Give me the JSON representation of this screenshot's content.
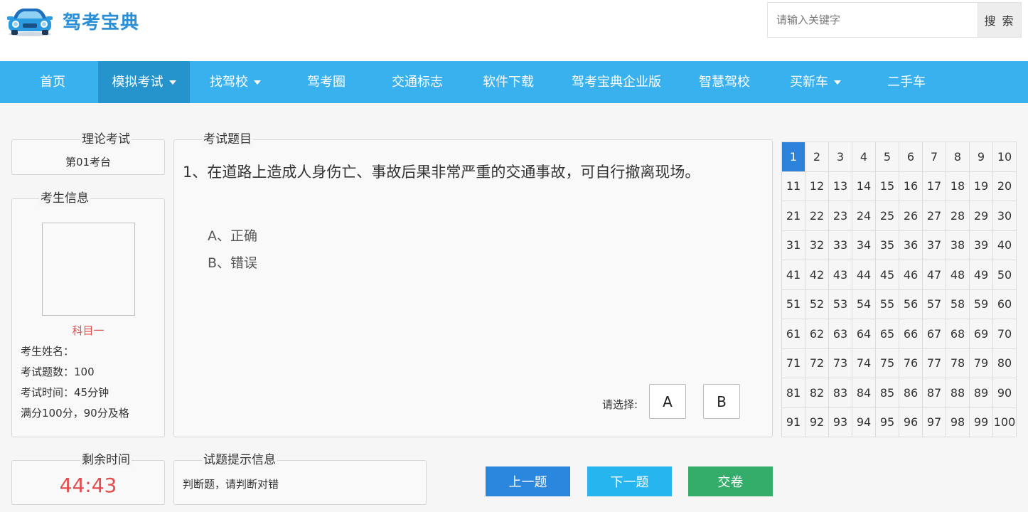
{
  "brand": {
    "name": "驾考宝典"
  },
  "search": {
    "placeholder": "请输入关键字",
    "button_label": "搜 索"
  },
  "nav": {
    "items": [
      {
        "label": "首页",
        "dropdown": false,
        "active": false
      },
      {
        "label": "模拟考试",
        "dropdown": true,
        "active": true
      },
      {
        "label": "找驾校",
        "dropdown": true,
        "active": false
      },
      {
        "label": "驾考圈",
        "dropdown": false,
        "active": false
      },
      {
        "label": "交通标志",
        "dropdown": false,
        "active": false
      },
      {
        "label": "软件下载",
        "dropdown": false,
        "active": false
      },
      {
        "label": "驾考宝典企业版",
        "dropdown": false,
        "active": false
      },
      {
        "label": "智慧驾校",
        "dropdown": false,
        "active": false
      },
      {
        "label": "买新车",
        "dropdown": true,
        "active": false
      },
      {
        "label": "二手车",
        "dropdown": false,
        "active": false
      }
    ]
  },
  "exam_info": {
    "legend": "理论考试",
    "station": "第01考台"
  },
  "student": {
    "legend": "考生信息",
    "subject": "科目一",
    "lines": [
      "考生姓名：",
      "考试题数：100",
      "考试时间：45分钟",
      "满分100分，90分及格"
    ]
  },
  "timer": {
    "legend": "剩余时间",
    "value": "44:43"
  },
  "question": {
    "legend": "考试题目",
    "text": "1、在道路上造成人身伤亡、事故后果非常严重的交通事故，可自行撤离现场。",
    "options": [
      "A、正确",
      "B、错误"
    ],
    "choose_label": "请选择:",
    "answer_buttons": [
      "A",
      "B"
    ]
  },
  "hint": {
    "legend": "试题提示信息",
    "text": "判断题，请判断对错"
  },
  "actions": {
    "prev": "上一题",
    "next": "下一题",
    "submit": "交卷"
  },
  "question_grid": {
    "total": 100,
    "current": 1
  },
  "colors": {
    "nav": "#3ab1ef",
    "nav_active": "#2594cd",
    "prev": "#2b86de",
    "next": "#27b5f0",
    "submit": "#34ad6b",
    "alert": "#e34c4c"
  }
}
